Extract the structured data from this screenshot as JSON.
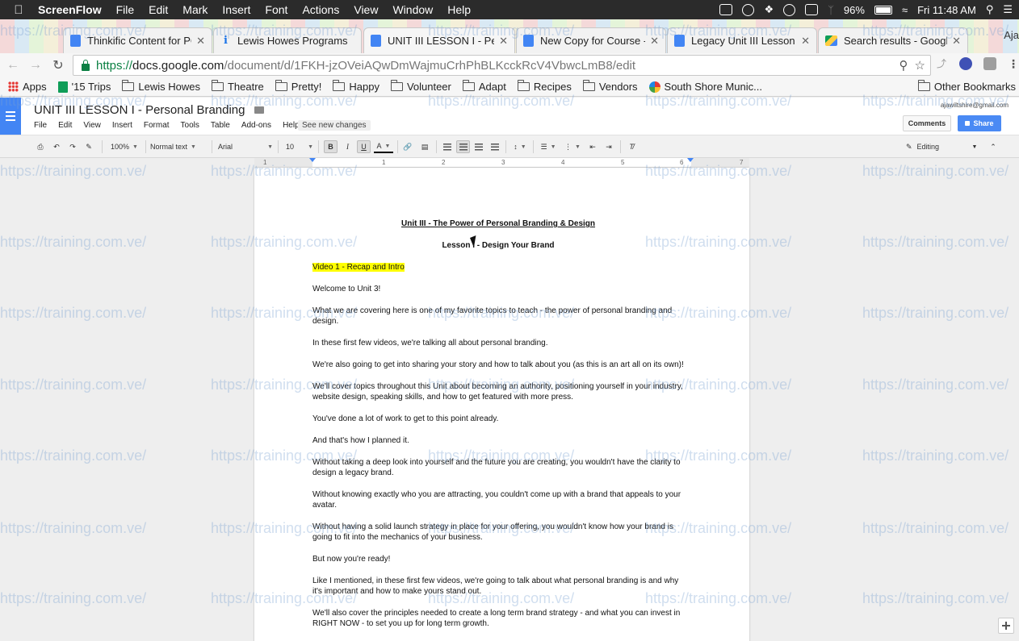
{
  "menubar": {
    "app_name": "ScreenFlow",
    "items": [
      "File",
      "Edit",
      "Mark",
      "Insert",
      "Font",
      "Actions",
      "View",
      "Window",
      "Help"
    ],
    "battery": "96%",
    "clock": "Fri 11:48 AM"
  },
  "tabs": [
    {
      "label": "Thinkific Content for PC",
      "icon": "docs-icon"
    },
    {
      "label": "Lewis Howes Programs",
      "icon": "info-icon"
    },
    {
      "label": "UNIT III LESSON I - Per",
      "icon": "docs-icon",
      "active": true
    },
    {
      "label": "New Copy for Course -",
      "icon": "docs-icon"
    },
    {
      "label": "Legacy Unit III Lesson I",
      "icon": "docs-icon"
    },
    {
      "label": "Search results - Googl",
      "icon": "drive-icon"
    }
  ],
  "tab_user": "Aja",
  "address": {
    "scheme": "https://",
    "host": "docs.google.com",
    "path": "/document/d/1FKH-jzOVeiAQwDmWajmuCrhPhBLKcckRcV4VbwcLmB8/edit"
  },
  "bookmarks": {
    "items": [
      {
        "label": "Apps",
        "icon": "apps-icon"
      },
      {
        "label": "'15 Trips",
        "icon": "sheet-icon"
      },
      {
        "label": "Lewis Howes",
        "icon": "folder-icon"
      },
      {
        "label": "Theatre",
        "icon": "folder-icon"
      },
      {
        "label": "Pretty!",
        "icon": "folder-icon"
      },
      {
        "label": "Happy",
        "icon": "folder-icon"
      },
      {
        "label": "Volunteer",
        "icon": "folder-icon"
      },
      {
        "label": "Adapt",
        "icon": "folder-icon"
      },
      {
        "label": "Recipes",
        "icon": "folder-icon"
      },
      {
        "label": "Vendors",
        "icon": "folder-icon"
      },
      {
        "label": "South Shore Munic...",
        "icon": "site-icon"
      }
    ],
    "other": "Other Bookmarks"
  },
  "doc": {
    "title": "UNIT III LESSON I - Personal Branding",
    "menu": [
      "File",
      "Edit",
      "View",
      "Insert",
      "Format",
      "Tools",
      "Table",
      "Add-ons",
      "Help"
    ],
    "see_changes": "See new changes",
    "account": "ajawiltshire@gmail.com",
    "comments_label": "Comments",
    "share_label": "Share"
  },
  "toolbar": {
    "zoom": "100%",
    "style": "Normal text",
    "font": "Arial",
    "size": "10",
    "bold": "B",
    "italic": "I",
    "underline": "U",
    "text_color": "A",
    "mode": "Editing"
  },
  "ruler": {
    "numbers": [
      "1",
      "1",
      "2",
      "3",
      "4",
      "5",
      "6",
      "7"
    ]
  },
  "content": {
    "heading1": "Unit III - The Power of Personal Branding & Design",
    "heading2": "Lesson I - Design Your Brand",
    "highlight": "Video 1 - Recap and Intro",
    "paragraphs": [
      "Welcome to Unit 3!",
      "What we are covering here is one of my favorite topics to teach - the power of personal branding and design.",
      "In these first few videos, we're talking all about personal branding.",
      "We're also going to get into sharing your story and how to talk about you (as this is an art all on its own)!",
      "We'll cover topics throughout this Unit about becoming an authority, positioning yourself in your industry, website design, speaking skills, and how to get featured with more press.",
      "You've done a lot of work to get to this point already.",
      "And that's how I planned it.",
      "Without taking a deep look into yourself and the future you are creating, you wouldn't have the clarity to design a legacy brand.",
      "Without knowing exactly who you are attracting, you couldn't come up with a brand that appeals to your avatar.",
      "Without having a solid launch strategy in place for your offering, you wouldn't know how your brand is going to fit into the mechanics of your business.",
      "But now you're ready!",
      "Like I mentioned, in these first few videos, we're going to talk about what personal branding is and why it's important and how to make yours stand out.",
      "We'll also cover the principles needed to create a long term brand strategy - and what you can invest in RIGHT NOW - to set you up for long term growth."
    ]
  },
  "watermark": "https://training.com.ve/"
}
